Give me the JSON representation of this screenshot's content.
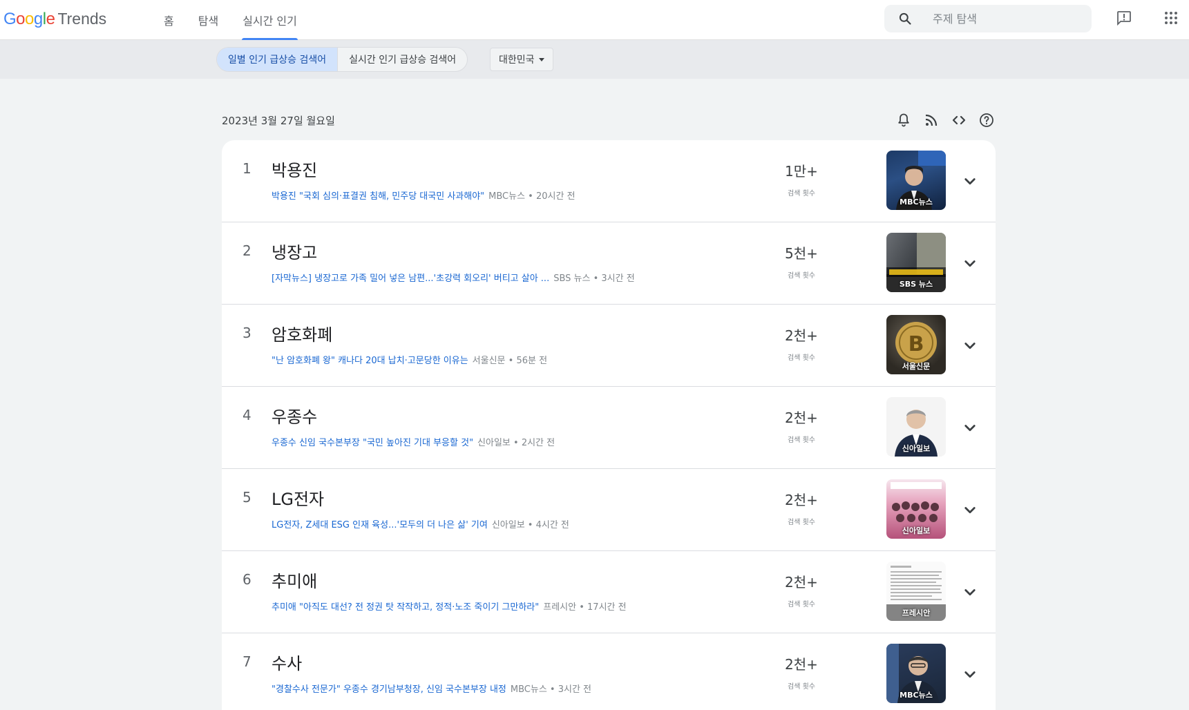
{
  "header": {
    "logo_google": "Google",
    "logo_trends": "Trends",
    "nav": [
      {
        "label": "홈"
      },
      {
        "label": "탐색"
      },
      {
        "label": "실시간 인기"
      }
    ],
    "search_placeholder": "주제 탐색"
  },
  "subbar": {
    "toggle": [
      {
        "label": "일별 인기 급상승 검색어",
        "selected": true
      },
      {
        "label": "실시간 인기 급상승 검색어",
        "selected": false
      }
    ],
    "country": "대한민국"
  },
  "date": "2023년 3월 27일 월요일",
  "count_label": "검색 횟수",
  "trends": [
    {
      "rank": "1",
      "title": "박용진",
      "headline": "박용진 \"국회 심의·표결권 침해, 민주당 대국민 사과해야\"",
      "meta": "MBC뉴스 • 20시간 전",
      "count": "1만+",
      "thumb_source": "MBC뉴스"
    },
    {
      "rank": "2",
      "title": "냉장고",
      "headline": "[자막뉴스] 냉장고로 가족 밀어 넣은 남편...'초강력 회오리' 버티고 살아 ...",
      "meta": "SBS 뉴스 • 3시간 전",
      "count": "5천+",
      "thumb_source": "SBS 뉴스"
    },
    {
      "rank": "3",
      "title": "암호화폐",
      "headline": "\"난 암호화폐 왕\" 캐나다 20대 납치·고문당한 이유는",
      "meta": "서울신문 • 56분 전",
      "count": "2천+",
      "thumb_source": "서울신문"
    },
    {
      "rank": "4",
      "title": "우종수",
      "headline": "우종수 신임 국수본부장 \"국민 높아진 기대 부응할 것\"",
      "meta": "신아일보 • 2시간 전",
      "count": "2천+",
      "thumb_source": "신아일보"
    },
    {
      "rank": "5",
      "title": "LG전자",
      "headline": "LG전자, Z세대 ESG 인재 육성...'모두의 더 나은 삶' 기여",
      "meta": "신아일보 • 4시간 전",
      "count": "2천+",
      "thumb_source": "신아일보"
    },
    {
      "rank": "6",
      "title": "추미애",
      "headline": "추미애 \"아직도 대선? 전 정권 탓 작작하고, 정적·노조 죽이기 그만하라\"",
      "meta": "프레시안 • 17시간 전",
      "count": "2천+",
      "thumb_source": "프레시안"
    },
    {
      "rank": "7",
      "title": "수사",
      "headline": "\"경찰수사 전문가\" 우종수 경기남부청장, 신임 국수본부장 내정",
      "meta": "MBC뉴스 • 3시간 전",
      "count": "2천+",
      "thumb_source": "MBC뉴스"
    }
  ],
  "colors": {
    "accent": "#4285f4",
    "link": "#1967d2",
    "toggle_selected_bg": "#d2e3fc"
  },
  "icons": [
    "search-icon",
    "feedback-icon",
    "apps-grid-icon",
    "bell-icon",
    "rss-icon",
    "embed-code-icon",
    "help-icon",
    "expand-chevron-icon"
  ]
}
